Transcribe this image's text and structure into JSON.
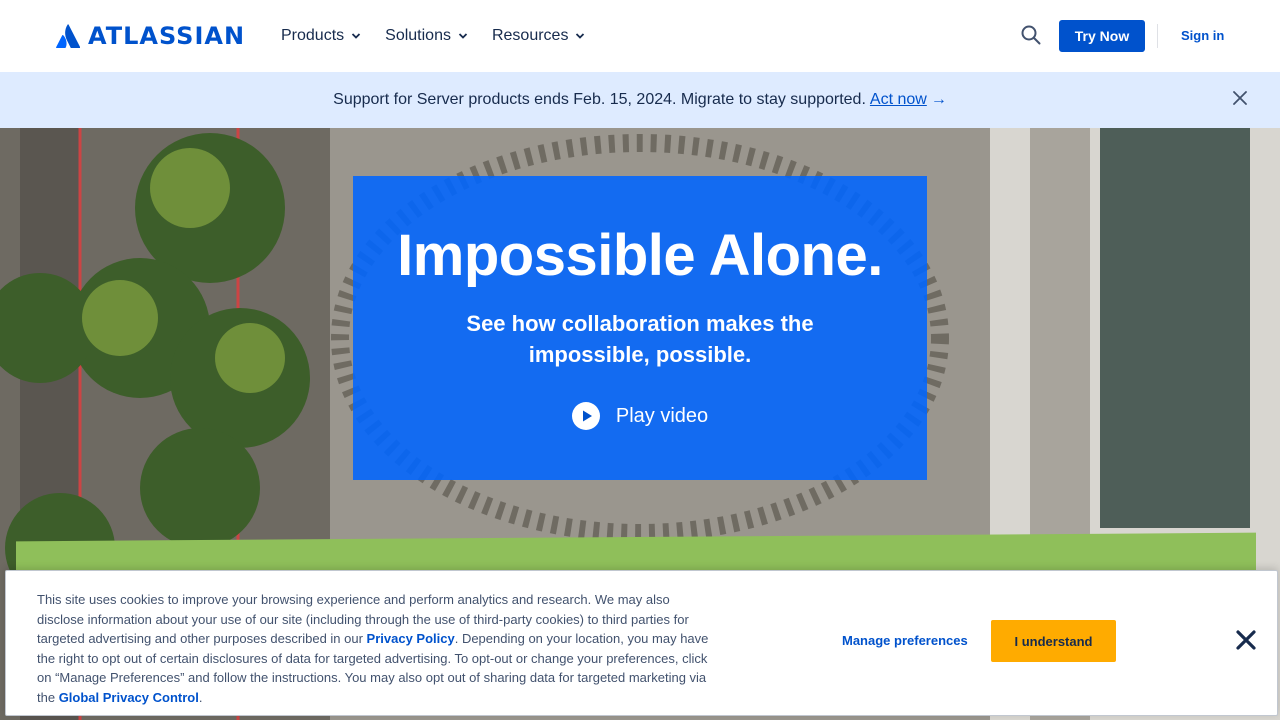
{
  "header": {
    "logo_text": "ATLASSIAN",
    "nav": [
      {
        "label": "Products"
      },
      {
        "label": "Solutions"
      },
      {
        "label": "Resources"
      }
    ],
    "try_label": "Try Now",
    "signin_label": "Sign in"
  },
  "banner": {
    "text": "Support for Server products ends Feb. 15, 2024. Migrate to stay supported.",
    "link_label": "Act now",
    "arrow": "→"
  },
  "hero": {
    "title": "Impossible Alone.",
    "subtitle": "See how collaboration makes the impossible, possible.",
    "play_label": "Play video"
  },
  "cookie": {
    "text_1": "This site uses cookies to improve your browsing experience and perform analytics and research. We may also disclose information about your use of our site (including through the use of third-party cookies) to third parties for targeted advertising and other purposes described in our ",
    "privacy_link": "Privacy Policy",
    "text_2": ". Depending on your location, you may have the right to opt out of certain disclosures of data for targeted advertising. To opt-out or change your preferences, click on “Manage Preferences” and follow the instructions. You may also opt out of sharing data for targeted marketing via the ",
    "gpc_link": "Global Privacy Control",
    "text_3": ".",
    "manage_label": "Manage preferences",
    "understand_label": "I understand"
  },
  "colors": {
    "brand_blue": "#0052CC",
    "banner_bg": "#DEEBFF",
    "hero_box": "#0065FF",
    "accept_button": "#FFAB00"
  },
  "icons": {
    "logo": "atlassian-logo-icon",
    "search": "search-icon",
    "banner_close": "close-icon",
    "play": "play-icon",
    "cookie_close": "close-icon"
  }
}
